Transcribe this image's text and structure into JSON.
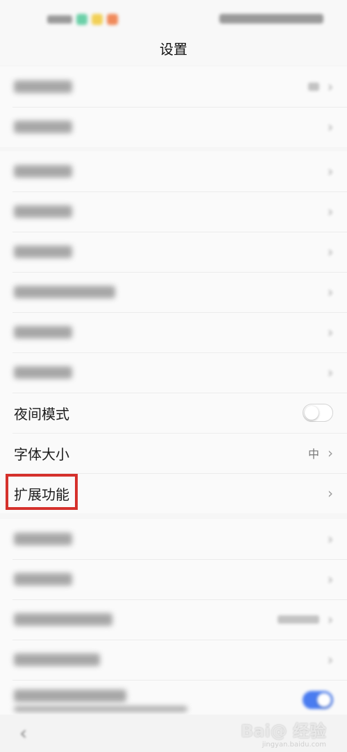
{
  "header": {
    "title": "设置"
  },
  "rows": {
    "night_mode": {
      "label": "夜间模式"
    },
    "font_size": {
      "label": "字体大小",
      "value": "中"
    },
    "extensions": {
      "label": "扩展功能"
    }
  },
  "watermark": {
    "text": "Bai@ 经验",
    "sub": "jingyan.baidu.com"
  }
}
